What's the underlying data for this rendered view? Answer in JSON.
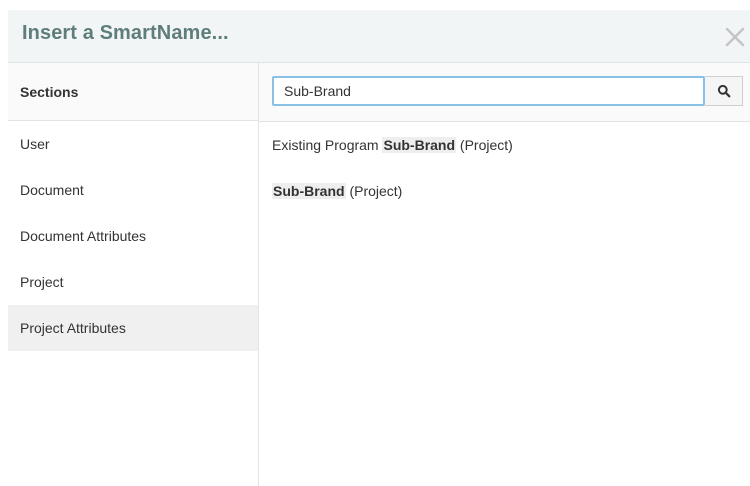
{
  "dialog": {
    "title": "Insert a SmartName...",
    "close_icon": "close-icon"
  },
  "sidebar": {
    "heading": "Sections",
    "items": [
      {
        "label": "User"
      },
      {
        "label": "Document"
      },
      {
        "label": "Document Attributes"
      },
      {
        "label": "Project"
      },
      {
        "label": "Project Attributes"
      }
    ],
    "selected": "Project Attributes"
  },
  "search": {
    "value": "Sub-Brand",
    "icon": "search-icon"
  },
  "results": [
    {
      "prefix": "Existing Program ",
      "match": "Sub-Brand",
      "suffix": " (Project)"
    },
    {
      "prefix": "",
      "match": "Sub-Brand",
      "suffix": " (Project)"
    }
  ],
  "colors": {
    "title": "#5e7d7b",
    "header_bg": "#f2f5f5",
    "input_focus_border": "#8ac0e6",
    "selected_bg": "#f0f0f0"
  }
}
